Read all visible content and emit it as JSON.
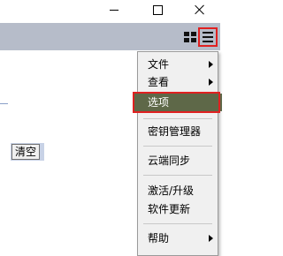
{
  "window": {
    "minimize_icon": "minimize-icon",
    "maximize_icon": "maximize-icon",
    "close_icon": "close-icon"
  },
  "toolbar": {
    "grid_icon": "grid-icon",
    "menu_icon": "hamburger-menu-icon",
    "menu_highlight_color": "#e02020"
  },
  "content": {
    "clear_label": "清空"
  },
  "menu": {
    "items": [
      {
        "label": "文件",
        "submenu": true
      },
      {
        "label": "查看",
        "submenu": true
      },
      {
        "label": "选项",
        "submenu": false,
        "highlighted": true
      },
      {
        "label": "密钥管理器",
        "submenu": false
      },
      {
        "label": "云端同步",
        "submenu": false
      },
      {
        "label": "激活/升级",
        "submenu": false
      },
      {
        "label": "软件更新",
        "submenu": false
      },
      {
        "label": "帮助",
        "submenu": true
      }
    ],
    "highlight_color": "#5e6848",
    "highlight_text_color": "#ffffff"
  }
}
